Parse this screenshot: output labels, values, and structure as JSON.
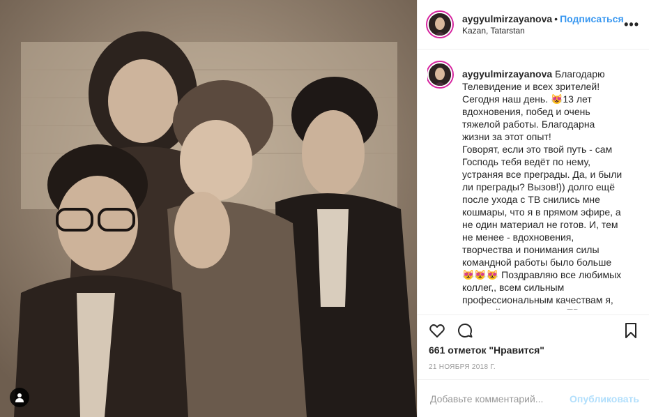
{
  "post": {
    "username": "aygyulmirzayanova",
    "follow_label": "Подписаться",
    "location": "Kazan, Tatarstan",
    "more_label": "•••"
  },
  "caption": {
    "username": "aygyulmirzayanova",
    "text": " Благодарю Телевидение и всех зрителей! Сегодня наш день. 😻13 лет вдохновения, побед и очень тяжелой работы. Благодарна жизни за этот опыт!\nГоворят, если это твой путь - сам Господь тебя ведёт по нему, устраняя все преграды. Да, и были ли преграды? Вызов!)) долго ещё после ухода с ТВ снились мне кошмары, что я в прямом эфире, а не один материал не готов. И, тем не менее - вдохновения, творчества и понимания силы командной работы было больше😻😻😻 Поздравляю все любимых коллег,, всем сильным профессиональным качествам я, пожалуй научилась на ТВ.\nА ещё с ТВ..."
  },
  "likes_label": "661 отметок \"Нравится\"",
  "date_label": "21 ноября 2018 г.",
  "comment": {
    "placeholder": "Добавьте комментарий...",
    "publish_label": "Опубликовать"
  },
  "icons": {
    "like": "heart-icon",
    "comment": "comment-icon",
    "share": "share-icon",
    "save": "bookmark-icon",
    "tag": "user-tag-icon"
  },
  "colors": {
    "link": "#3897f0",
    "publish_disabled": "#b2dffc",
    "story_ring": "#d6249f"
  }
}
